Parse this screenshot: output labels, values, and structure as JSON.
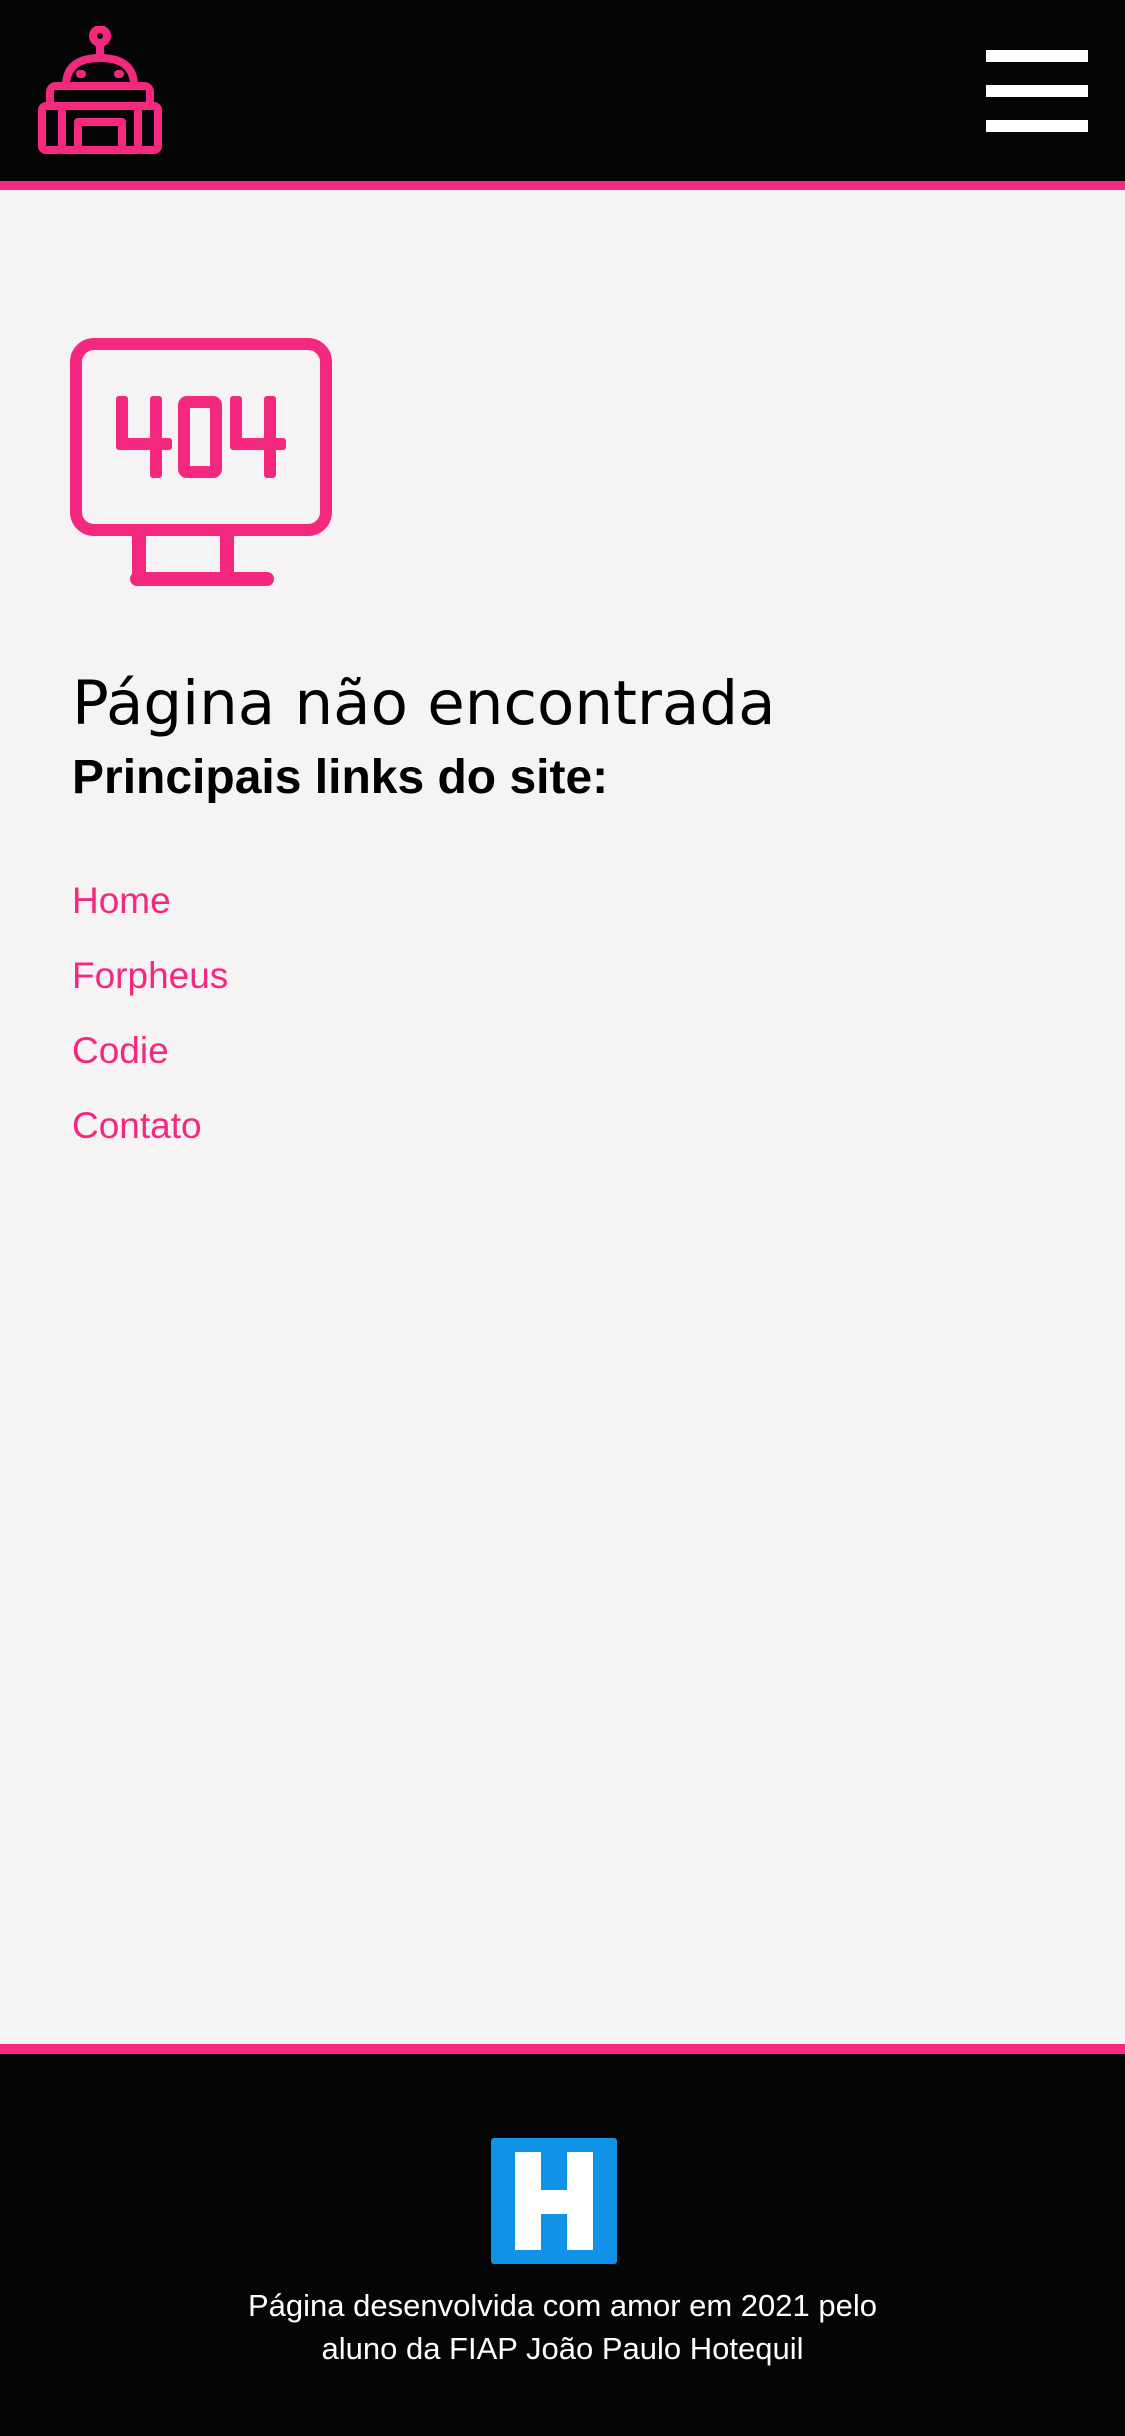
{
  "header": {
    "logo_icon": "robot-icon",
    "menu_icon": "hamburger-menu-icon"
  },
  "main": {
    "illustration_icon": "monitor-404-icon",
    "illustration_text": "404",
    "title": "Página não encontrada",
    "subtitle": "Principais links do site:",
    "links": [
      {
        "label": "Home"
      },
      {
        "label": "Forpheus"
      },
      {
        "label": "Codie"
      },
      {
        "label": "Contato"
      }
    ]
  },
  "footer": {
    "logo_icon": "h-logo-icon",
    "logo_letter": "H",
    "credit_line1": "Página desenvolvida com amor em 2021 pelo",
    "credit_line2": "aluno da FIAP João Paulo Hotequil"
  },
  "colors": {
    "accent": "#f5287f",
    "header_bg": "#050505",
    "page_bg": "#f6f3f4",
    "h_logo_blue": "#1192e8"
  }
}
